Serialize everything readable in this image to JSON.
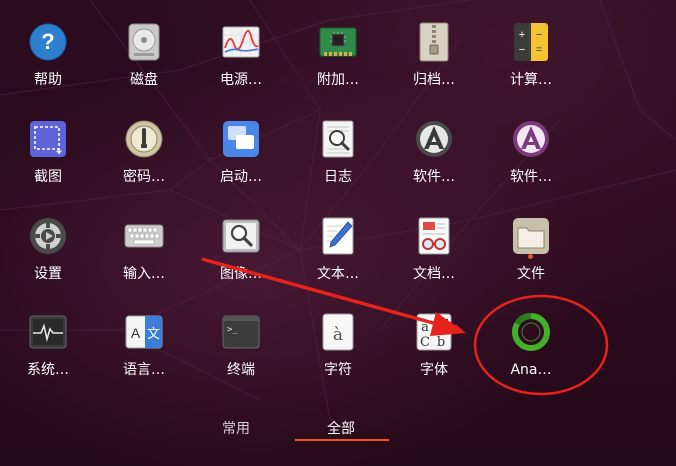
{
  "apps": [
    {
      "label": "帮助",
      "icon": "help-icon"
    },
    {
      "label": "磁盘",
      "icon": "disk-icon"
    },
    {
      "label": "电源…",
      "icon": "power-statistics-icon"
    },
    {
      "label": "附加…",
      "icon": "chip-icon"
    },
    {
      "label": "归档…",
      "icon": "archive-icon"
    },
    {
      "label": "计算…",
      "icon": "calculator-icon"
    },
    {
      "label": "截图",
      "icon": "screenshot-icon"
    },
    {
      "label": "密码…",
      "icon": "keyring-icon"
    },
    {
      "label": "启动…",
      "icon": "startup-icon"
    },
    {
      "label": "日志",
      "icon": "logs-icon"
    },
    {
      "label": "软件…",
      "icon": "software-updater-icon"
    },
    {
      "label": "软件…",
      "icon": "software-center-icon"
    },
    {
      "label": "设置",
      "icon": "settings-icon"
    },
    {
      "label": "输入…",
      "icon": "keyboard-icon"
    },
    {
      "label": "图像…",
      "icon": "image-viewer-icon"
    },
    {
      "label": "文本…",
      "icon": "text-editor-icon"
    },
    {
      "label": "文档…",
      "icon": "document-viewer-icon"
    },
    {
      "label": "文件",
      "icon": "files-icon"
    },
    {
      "label": "系统…",
      "icon": "system-monitor-icon"
    },
    {
      "label": "语言…",
      "icon": "language-icon"
    },
    {
      "label": "终端",
      "icon": "terminal-icon"
    },
    {
      "label": "字符",
      "icon": "characters-icon"
    },
    {
      "label": "字体",
      "icon": "fonts-icon"
    },
    {
      "label": "Ana…",
      "icon": "anaconda-navigator-icon"
    }
  ],
  "tabs": [
    {
      "label": "常用",
      "active": false
    },
    {
      "label": "全部",
      "active": true
    }
  ],
  "colors": {
    "accent": "#e95420",
    "annotation": "#e5221c"
  }
}
